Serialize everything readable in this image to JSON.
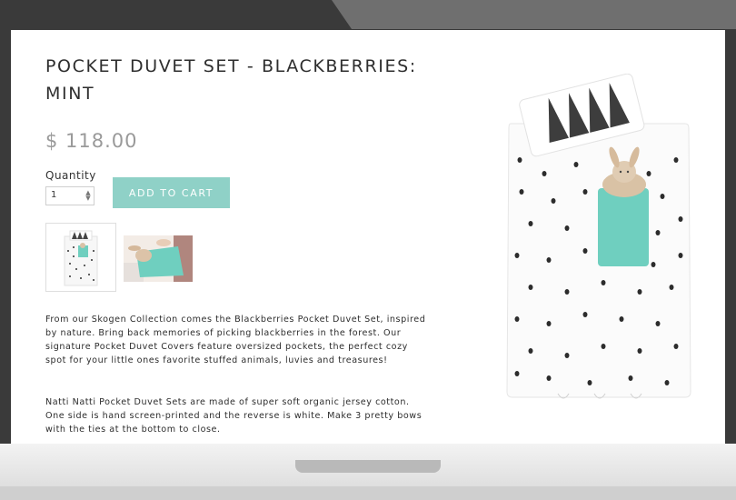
{
  "product": {
    "title": "POCKET DUVET SET - BLACKBERRIES: MINT",
    "price": "$ 118.00",
    "quantity_label": "Quantity",
    "quantity_value": "1",
    "add_to_cart_label": "ADD TO CART",
    "description": [
      "From our Skogen Collection comes the Blackberries Pocket Duvet Set, inspired by nature. Bring back memories of picking blackberries in the forest. Our signature Pocket Duvet Covers feature oversized pockets, the perfect cozy spot for your little ones favorite stuffed animals, luvies and treasures!",
      "Natti Natti Pocket Duvet Sets are made of super soft organic jersey cotton. One side is hand screen-printed and the reverse is white. Make 3 pretty bows with the ties at the bottom to close."
    ]
  },
  "colors": {
    "accent": "#8fd1c7",
    "title_text": "#2e2e2e",
    "price_text": "#9a9a9a",
    "bezel": "#3a3a3a"
  }
}
